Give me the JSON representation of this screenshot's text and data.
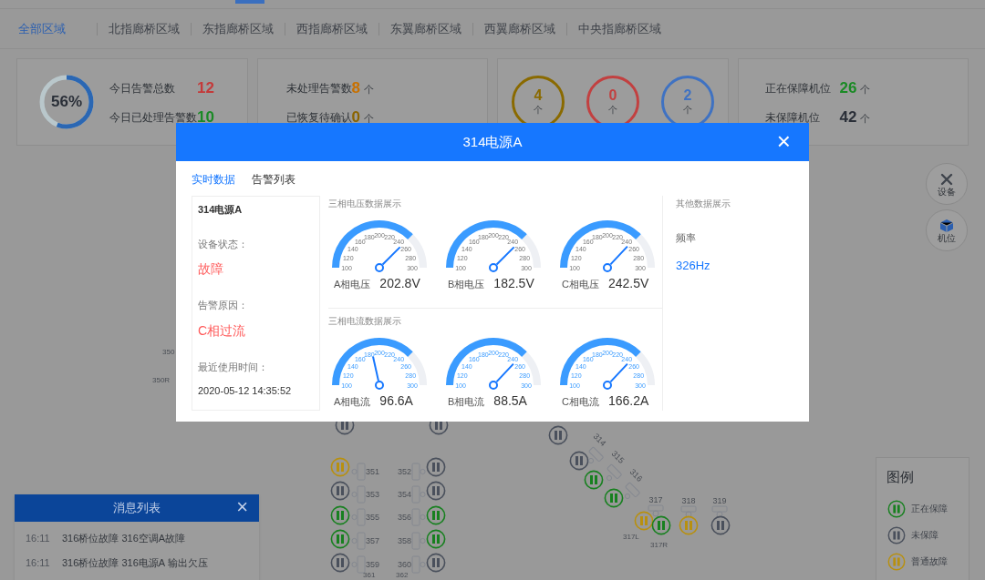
{
  "region_tabs": [
    {
      "label": "全部区域",
      "selected": true
    },
    {
      "label": "北指廊桥区域",
      "selected": false
    },
    {
      "label": "东指廊桥区域",
      "selected": false
    },
    {
      "label": "西指廊桥区域",
      "selected": false
    },
    {
      "label": "东翼廊桥区域",
      "selected": false
    },
    {
      "label": "西翼廊桥区域",
      "selected": false
    },
    {
      "label": "中央指廊桥区域",
      "selected": false
    }
  ],
  "summary_cards": [
    {
      "kind": "ring",
      "percent": "56%",
      "level": 0.56,
      "stats": [
        {
          "label": "今日告警总数",
          "value": "12",
          "color": "#c43a3a"
        },
        {
          "label": "今日已处理告警数",
          "value": "10",
          "color": "#1a8a25"
        }
      ]
    },
    {
      "kind": "stats",
      "stats": [
        {
          "label": "未处理告警数",
          "value": "8",
          "unit": "个",
          "color": "#c77000"
        },
        {
          "label": "已恢复待确认",
          "value": "0",
          "unit": "个",
          "color": "#8a6400"
        }
      ]
    },
    {
      "kind": "circles",
      "circles": [
        {
          "value": "4",
          "unit": "个",
          "color": "#8a6a00"
        },
        {
          "value": "0",
          "unit": "个",
          "color": "#c24040"
        },
        {
          "value": "2",
          "unit": "个",
          "color": "#3f72c2"
        }
      ]
    },
    {
      "kind": "stats",
      "stats": [
        {
          "label": "正在保障机位",
          "value": "26",
          "unit": "个",
          "color": "#1a8a25"
        },
        {
          "label": "未保障机位",
          "value": "42",
          "unit": "个",
          "color": "#2a2f38"
        }
      ]
    }
  ],
  "tool_buttons": [
    {
      "label": "设备",
      "kind": "tools"
    },
    {
      "label": "机位",
      "kind": "cube"
    }
  ],
  "map_items": [
    {
      "kind": "tag",
      "label": "350"
    },
    {
      "kind": "tag",
      "label": "350R"
    },
    {
      "kind": "icon",
      "color": "#4a505c"
    },
    {
      "kind": "icon",
      "color": "#4a505c"
    },
    {
      "kind": "icon",
      "color": "#b8900f"
    },
    {
      "kind": "slot",
      "label": "351"
    },
    {
      "kind": "icon",
      "color": "#4a505c"
    },
    {
      "kind": "slot",
      "label": "353"
    },
    {
      "kind": "icon",
      "color": "#17801f"
    },
    {
      "kind": "slot",
      "label": "355"
    },
    {
      "kind": "icon",
      "color": "#17801f"
    },
    {
      "kind": "slot",
      "label": "357"
    },
    {
      "kind": "icon",
      "color": "#4a505c"
    },
    {
      "kind": "slot",
      "label": "359"
    },
    {
      "kind": "slot",
      "label": "352"
    },
    {
      "kind": "icon",
      "color": "#4a505c"
    },
    {
      "kind": "slot",
      "label": "354"
    },
    {
      "kind": "icon",
      "color": "#4a505c"
    },
    {
      "kind": "slot",
      "label": "356"
    },
    {
      "kind": "icon",
      "color": "#17801f"
    },
    {
      "kind": "slot",
      "label": "358"
    },
    {
      "kind": "icon",
      "color": "#17801f"
    },
    {
      "kind": "slot",
      "label": "360"
    },
    {
      "kind": "icon",
      "color": "#4a505c"
    },
    {
      "kind": "tag",
      "label": "361"
    },
    {
      "kind": "tag",
      "label": "362"
    },
    {
      "kind": "icon",
      "color": "#4a505c"
    },
    {
      "kind": "icon",
      "color": "#4a505c"
    },
    {
      "kind": "slot",
      "label": "314"
    },
    {
      "kind": "icon",
      "color": "#17801f"
    },
    {
      "kind": "slot",
      "label": "315"
    },
    {
      "kind": "icon",
      "color": "#17801f"
    },
    {
      "kind": "slot",
      "label": "316"
    },
    {
      "kind": "slot",
      "label": "317"
    },
    {
      "kind": "slot",
      "label": "318"
    },
    {
      "kind": "slot",
      "label": "319"
    },
    {
      "kind": "icon",
      "color": "#b8900f"
    },
    {
      "kind": "icon",
      "color": "#17801f"
    },
    {
      "kind": "icon",
      "color": "#b8900f"
    },
    {
      "kind": "icon",
      "color": "#4a505c"
    },
    {
      "kind": "tag",
      "label": "317L"
    },
    {
      "kind": "tag",
      "label": "317R"
    }
  ],
  "legend": {
    "title": "图例",
    "items": [
      {
        "label": "正在保障",
        "color": "#17801f"
      },
      {
        "label": "未保障",
        "color": "#4a505c"
      },
      {
        "label": "普通故障",
        "color": "#b8900f"
      }
    ]
  },
  "message_panel": {
    "title": "消息列表",
    "close": "×",
    "rows": [
      {
        "time": "16:11",
        "text": "316桥位故障 316空调A故障"
      },
      {
        "time": "16:11",
        "text": "316桥位故障 316电源A 输出欠压"
      }
    ]
  },
  "modal": {
    "title": "314电源A",
    "close": "×",
    "tabs": [
      {
        "label": "实时数据",
        "selected": true
      },
      {
        "label": "告警列表",
        "selected": false
      }
    ],
    "device": {
      "name": "314电源A",
      "fields": [
        {
          "label": "设备状态：",
          "value": "故障",
          "kind": "alert"
        },
        {
          "label": "告警原因：",
          "value": "C相过流",
          "kind": "alert"
        },
        {
          "label": "最近使用时间：",
          "value": "2020-05-12 14:35:52",
          "kind": "plain"
        }
      ]
    },
    "sections": [
      {
        "title": "三相电压数据展示",
        "kind": "voltage",
        "gauges": [
          {
            "label": "A相电压",
            "reading": "202.8V",
            "level": 0.75,
            "ticks": [
              "100",
              "120",
              "140",
              "160",
              "180",
              "200",
              "220",
              "240",
              "260",
              "280",
              "300"
            ]
          },
          {
            "label": "B相电压",
            "reading": "182.5V",
            "level": 0.75,
            "ticks": [
              "100",
              "120",
              "140",
              "160",
              "180",
              "200",
              "220",
              "240",
              "260",
              "280",
              "300"
            ]
          },
          {
            "label": "C相电压",
            "reading": "242.5V",
            "level": 0.74,
            "ticks": [
              "100",
              "120",
              "140",
              "160",
              "180",
              "200",
              "220",
              "240",
              "260",
              "280",
              "300"
            ]
          }
        ]
      },
      {
        "title": "三相电流数据展示",
        "kind": "current",
        "gauges": [
          {
            "label": "A相电流",
            "reading": "96.6A",
            "level": 0.43,
            "ticks": [
              "100",
              "120",
              "140",
              "160",
              "180",
              "200",
              "220",
              "240",
              "260",
              "280",
              "300"
            ]
          },
          {
            "label": "B相电流",
            "reading": "88.5A",
            "level": 0.74,
            "ticks": [
              "100",
              "120",
              "140",
              "160",
              "180",
              "200",
              "220",
              "240",
              "260",
              "280",
              "300"
            ]
          },
          {
            "label": "C相电流",
            "reading": "166.2A",
            "level": 0.74,
            "ticks": [
              "100",
              "120",
              "140",
              "160",
              "180",
              "200",
              "220",
              "240",
              "260",
              "280",
              "300"
            ]
          }
        ]
      }
    ],
    "other": {
      "title": "其他数据展示",
      "items": [
        {
          "label": "频率",
          "value": "326Hz"
        }
      ]
    }
  }
}
